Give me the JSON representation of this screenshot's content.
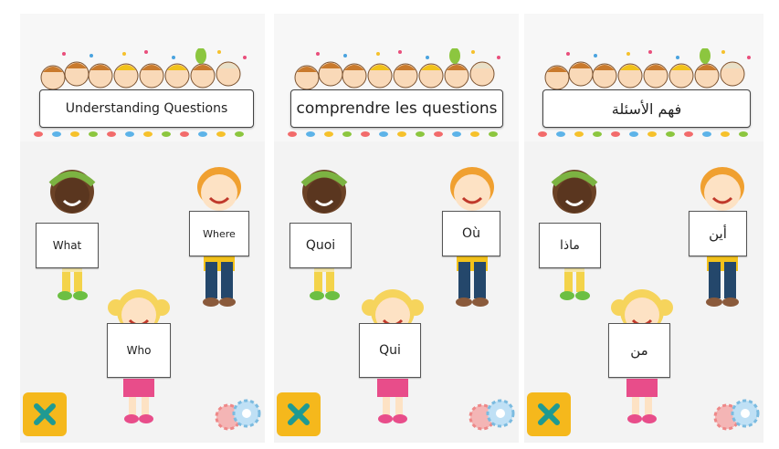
{
  "panels": [
    {
      "id": "english",
      "title": "Understanding Questions",
      "words": {
        "what": "What",
        "where": "Where",
        "who": "Who"
      }
    },
    {
      "id": "french",
      "title": "comprendre les questions",
      "words": {
        "what": "Quoi",
        "where": "Où",
        "who": "Qui"
      }
    },
    {
      "id": "arabic",
      "title": "فهم الأسئلة",
      "words": {
        "what": "ماذا",
        "where": "أين",
        "who": "من"
      }
    }
  ],
  "icons": {
    "close": "close-icon",
    "gears": "gears-icon"
  },
  "colors": {
    "close_button": "#f5b81c",
    "close_x": "#1f9a92"
  }
}
